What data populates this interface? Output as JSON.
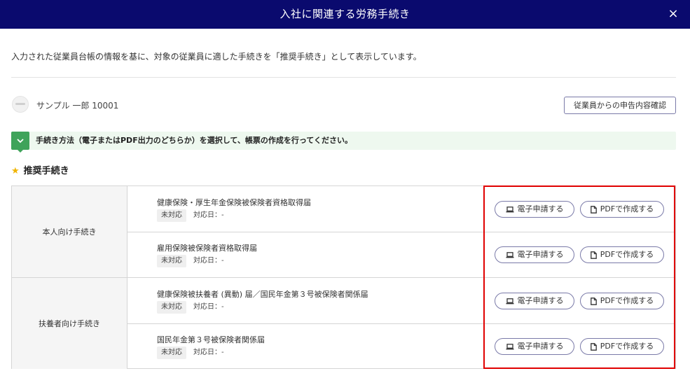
{
  "header": {
    "title": "入社に関連する労務手続き",
    "close_label": "×"
  },
  "intro_text": "入力された従業員台帳の情報を基に、対象の従業員に適した手続きを「推奨手続き」として表示しています。",
  "employee": {
    "name_label": "サンプル 一郎 10001"
  },
  "confirm_button_label": "従業員からの申告内容確認",
  "notice": {
    "text": "手続き方法（電子またはPDF出力のどちらか）を選択して、帳票の作成を行ってください。"
  },
  "section": {
    "title": "推奨手続き"
  },
  "groups": [
    {
      "label": "本人向け手続き"
    },
    {
      "label": "扶養者向け手続き"
    }
  ],
  "procedures": [
    {
      "name": "健康保険・厚生年金保険被保険者資格取得届",
      "status": "未対応",
      "due": "対応日：-"
    },
    {
      "name": "雇用保険被保険者資格取得届",
      "status": "未対応",
      "due": "対応日：-"
    },
    {
      "name": "健康保険被扶養者 (異動) 届／国民年金第３号被保険者関係届",
      "status": "未対応",
      "due": "対応日：-"
    },
    {
      "name": "国民年金第３号被保険者関係届",
      "status": "未対応",
      "due": "対応日：-"
    }
  ],
  "buttons": {
    "electronic_label": "電子申請する",
    "pdf_label": "PDFで作成する"
  },
  "icons": {
    "close": "close-icon",
    "notice": "chevron-down-icon",
    "star": "star-icon",
    "electronic": "laptop-icon",
    "pdf": "document-icon"
  },
  "colors": {
    "header_bg": "#0a0a6e",
    "notice_accent": "#3fa35a",
    "notice_bg": "#eef8ef",
    "star": "#f0b400",
    "highlight": "#e00000"
  }
}
